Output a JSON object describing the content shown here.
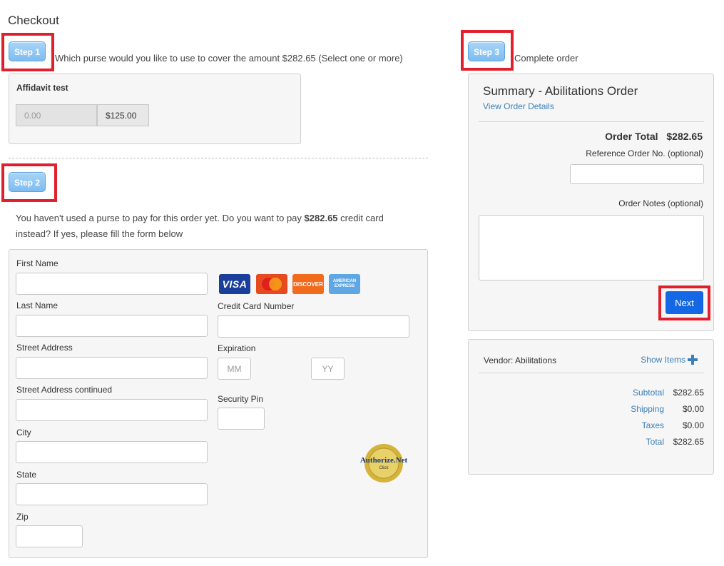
{
  "page": {
    "title": "Checkout"
  },
  "step1": {
    "badge": "Step 1",
    "text": "Which purse would you like to use to cover the amount $282.65 (Select one or more)",
    "purse_name": "Affidavit test",
    "purse_input_value": "0.00",
    "purse_balance": "$125.00"
  },
  "step2": {
    "badge": "Step 2",
    "intro_before": "You haven't used a purse to pay for this order yet. Do you want to pay ",
    "intro_amount": "$282.65",
    "intro_after": " credit card",
    "intro_line2": "instead? If yes, please fill the form below",
    "fields": {
      "first_name": "First Name",
      "last_name": "Last Name",
      "street": "Street Address",
      "street2": "Street Address continued",
      "city": "City",
      "state": "State",
      "zip": "Zip",
      "cc_number": "Credit Card Number",
      "expiration": "Expiration",
      "mm_placeholder": "MM",
      "yy_placeholder": "YY",
      "security_pin": "Security Pin"
    },
    "cards": {
      "visa": "VISA",
      "mastercard": "MasterCard",
      "discover": "DISCOVER",
      "amex": "AMERICAN EXPRESS"
    },
    "seal": {
      "name": "Authorize.Net",
      "sub": "Click"
    }
  },
  "step3": {
    "badge": "Step 3",
    "text": "Complete order",
    "summary_title": "Summary - Abilitations Order",
    "view_details": "View Order Details",
    "order_total_label": "Order Total",
    "order_total_value": "$282.65",
    "ref_label": "Reference Order No. (optional)",
    "notes_label": "Order Notes (optional)",
    "next_label": "Next"
  },
  "vendor": {
    "label": "Vendor: Abilitations",
    "show_items": "Show Items",
    "rows": [
      {
        "label": "Subtotal",
        "value": "$282.65"
      },
      {
        "label": "Shipping",
        "value": "$0.00"
      },
      {
        "label": "Taxes",
        "value": "$0.00"
      },
      {
        "label": "Total",
        "value": "$282.65"
      }
    ]
  },
  "colors": {
    "highlight": "#e0202d",
    "link": "#3b7fb6",
    "next_button": "#1468e6",
    "step_badge": "#7dbdf0"
  }
}
